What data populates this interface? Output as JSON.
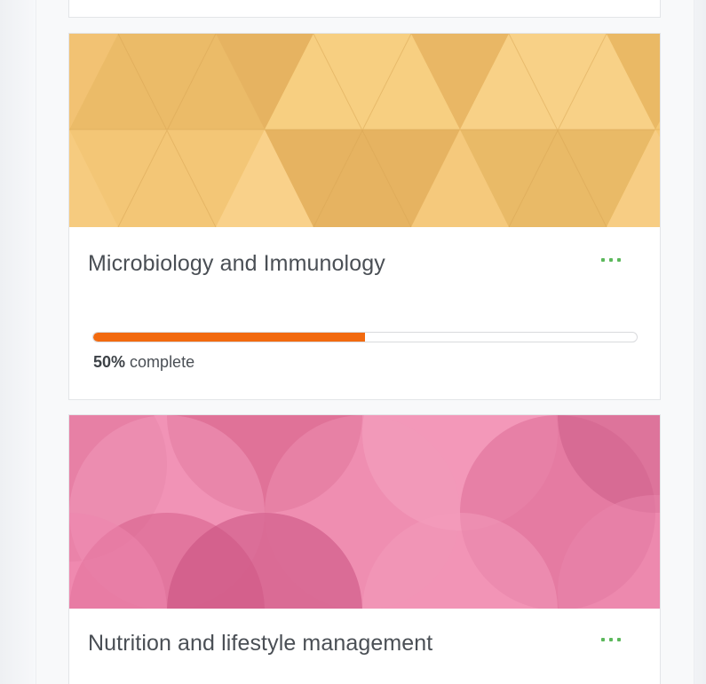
{
  "courses": [
    {
      "title": "Microbiology and Immunology",
      "progress_percent": 50,
      "progress_value": "50%",
      "progress_suffix": "complete",
      "banner_pattern": "triangles",
      "banner_colors": [
        "#f5c875",
        "#e8b662",
        "#f9d48c"
      ],
      "menu_icon": "more-dots-icon",
      "menu_color": "#5cb85c"
    },
    {
      "title": "Nutrition and lifestyle management",
      "banner_pattern": "circles",
      "banner_colors": [
        "#ef86ab",
        "#d8608c",
        "#f79bbc"
      ],
      "menu_icon": "more-dots-icon",
      "menu_color": "#5cb85c"
    }
  ],
  "progress_color": "#f26a0f"
}
